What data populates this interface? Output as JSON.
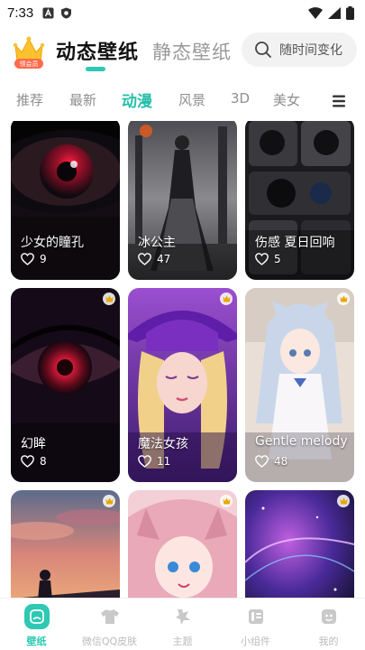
{
  "status_bar": {
    "time": "7:33"
  },
  "header": {
    "vip_badge": "领会员",
    "tab_dynamic": "动态壁纸",
    "tab_static": "静态壁纸",
    "search_placeholder": "随时间变化"
  },
  "categories": {
    "items": [
      "推荐",
      "最新",
      "动漫",
      "风景",
      "3D",
      "美女"
    ],
    "active": "动漫"
  },
  "cards": [
    {
      "title": "少女的瞳孔",
      "likes": "9",
      "vip": false
    },
    {
      "title": "冰公主",
      "likes": "47",
      "vip": false
    },
    {
      "title": "伤感 夏日回响",
      "likes": "5",
      "vip": false
    },
    {
      "title": "幻眸",
      "likes": "8",
      "vip": true
    },
    {
      "title": "魔法女孩",
      "likes": "11",
      "vip": true
    },
    {
      "title": "Gentle melody",
      "likes": "48",
      "vip": true
    },
    {
      "title": "",
      "likes": "",
      "vip": true
    },
    {
      "title": "",
      "likes": "",
      "vip": true
    },
    {
      "title": "",
      "likes": "",
      "vip": true
    }
  ],
  "bottom_nav": {
    "items": [
      "壁纸",
      "微信QQ皮肤",
      "主题",
      "小组件",
      "我的"
    ],
    "active": "壁纸"
  },
  "colors": {
    "accent": "#2ec9b3",
    "inactive": "#9a9a9a"
  },
  "icons": {
    "status": [
      "a-icon",
      "shield-icon",
      "wifi-icon",
      "signal-icon",
      "battery-icon"
    ],
    "nav": [
      "wallpaper-icon",
      "shirt-icon",
      "theme-icon",
      "widget-icon",
      "profile-icon"
    ]
  }
}
